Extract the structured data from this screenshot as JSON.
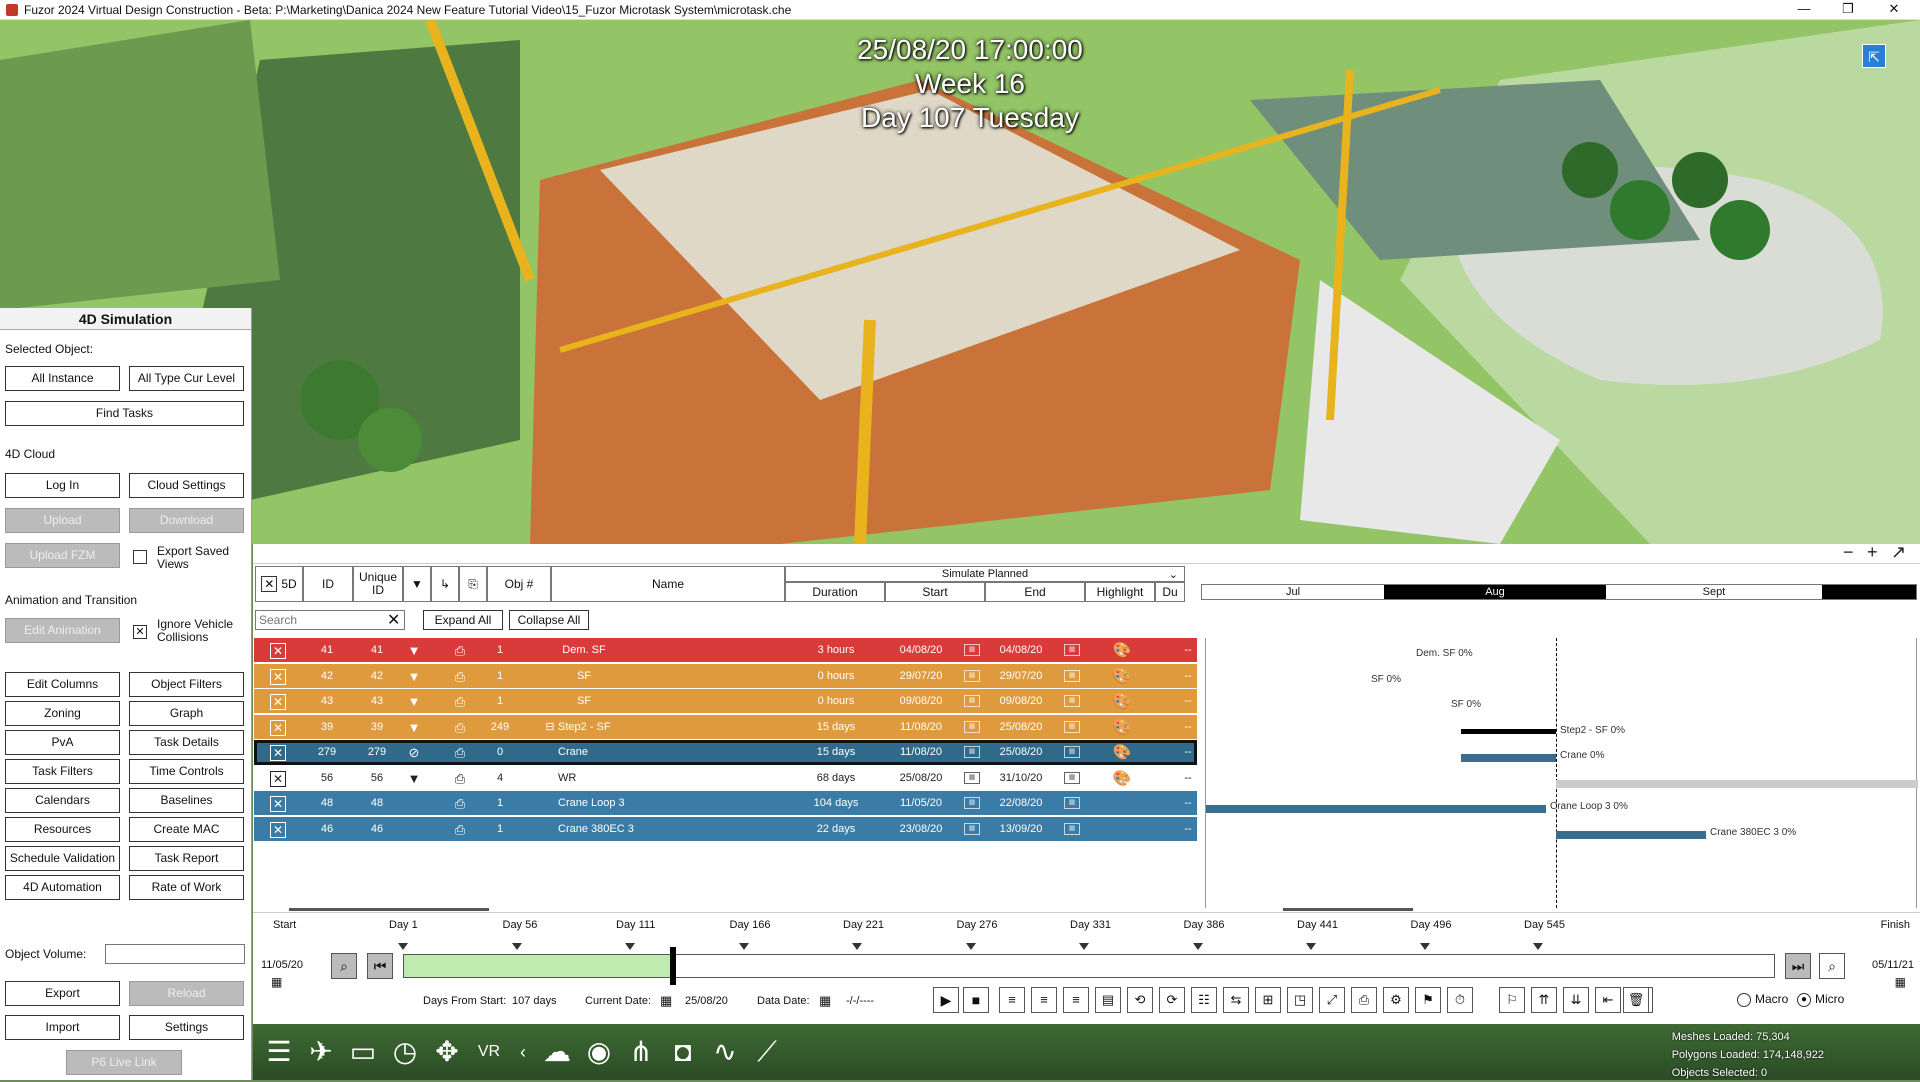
{
  "window": {
    "title": "Fuzor 2024 Virtual Design Construction - Beta: P:\\Marketing\\Danica 2024 New Feature Tutorial Video\\15_Fuzor Microtask System\\microtask.che",
    "minimize": "—",
    "restore": "❐",
    "close": "✕"
  },
  "overlay": {
    "datetime": "25/08/20 17:00:00",
    "week": "Week 16",
    "day": "Day 107 Tuesday"
  },
  "left_panel": {
    "title": "4D Simulation",
    "selected_object_label": "Selected Object:",
    "all_instance": "All Instance",
    "all_type_cur_level": "All Type Cur Level",
    "find_tasks": "Find Tasks",
    "cloud_label": "4D Cloud",
    "log_in": "Log In",
    "cloud_settings": "Cloud Settings",
    "upload": "Upload",
    "download": "Download",
    "upload_fzm": "Upload FZM",
    "export_saved_views": "Export Saved Views",
    "anim_label": "Animation and Transition",
    "edit_animation": "Edit Animation",
    "ignore_vehicle": "Ignore Vehicle Collisions",
    "buttons": [
      "Edit Columns",
      "Object Filters",
      "Zoning",
      "Graph",
      "PvA",
      "Task Details",
      "Task Filters",
      "Time Controls",
      "Calendars",
      "Baselines",
      "Resources",
      "Create MAC",
      "Schedule Validation",
      "Task Report",
      "4D Automation",
      "Rate of Work"
    ],
    "object_volume_label": "Object Volume:",
    "export": "Export",
    "reload": "Reload",
    "import": "Import",
    "settings": "Settings",
    "p6_live_link": "P6 Live Link"
  },
  "grid": {
    "hdr_5d": "5D",
    "hdr_id": "ID",
    "hdr_unique_id": "Unique ID",
    "hdr_obj": "Obj #",
    "hdr_name": "Name",
    "simulate_mode": "Simulate Planned",
    "hdr_duration": "Duration",
    "hdr_start": "Start",
    "hdr_end": "End",
    "hdr_highlight": "Highlight",
    "hdr_du": "Du",
    "search_placeholder": "Search",
    "expand_all": "Expand All",
    "collapse_all": "Collapse All",
    "rows": [
      {
        "id": "41",
        "uid": "41",
        "obj": "1",
        "name": "Dem. SF",
        "duration": "3 hours",
        "start": "04/08/20",
        "end": "04/08/20",
        "color": "#d93a3a"
      },
      {
        "id": "42",
        "uid": "42",
        "obj": "1",
        "name": "SF",
        "duration": "0 hours",
        "start": "29/07/20",
        "end": "29/07/20",
        "color": "#e09a3e"
      },
      {
        "id": "43",
        "uid": "43",
        "obj": "1",
        "name": "SF",
        "duration": "0 hours",
        "start": "09/08/20",
        "end": "09/08/20",
        "color": "#e09a3e"
      },
      {
        "id": "39",
        "uid": "39",
        "obj": "249",
        "name": "Step2 - SF",
        "duration": "15 days",
        "start": "11/08/20",
        "end": "25/08/20",
        "color": "#e09a3e"
      },
      {
        "id": "279",
        "uid": "279",
        "obj": "0",
        "name": "Crane",
        "duration": "15 days",
        "start": "11/08/20",
        "end": "25/08/20",
        "color": "#2f6a8a"
      },
      {
        "id": "56",
        "uid": "56",
        "obj": "4",
        "name": "WR",
        "duration": "68 days",
        "start": "25/08/20",
        "end": "31/10/20",
        "color": "#ffffff"
      },
      {
        "id": "48",
        "uid": "48",
        "obj": "1",
        "name": "Crane Loop 3",
        "duration": "104 days",
        "start": "11/05/20",
        "end": "22/08/20",
        "color": "#3a7ca5"
      },
      {
        "id": "46",
        "uid": "46",
        "obj": "1",
        "name": "Crane 380EC 3",
        "duration": "22 days",
        "start": "23/08/20",
        "end": "13/09/20",
        "color": "#3a7ca5"
      }
    ],
    "months": [
      "Jul",
      "Aug",
      "Sept"
    ],
    "gantt_labels": [
      "Dem. SF  0%",
      "SF  0%",
      "SF  0%",
      "Step2 - SF  0%",
      "Crane  0%",
      "Crane Loop 3  0%",
      "Crane 380EC 3  0%"
    ]
  },
  "timeline": {
    "start_label": "Start",
    "start_date": "11/05/20",
    "finish_label": "Finish",
    "finish_date": "05/11/21",
    "days": [
      "Day 1",
      "Day 56",
      "Day 111",
      "Day 166",
      "Day 221",
      "Day 276",
      "Day 331",
      "Day 386",
      "Day 441",
      "Day 496",
      "Day 545"
    ],
    "days_from_start_label": "Days From Start:",
    "days_from_start": "107 days",
    "current_date_label": "Current Date:",
    "current_date": "25/08/20",
    "data_date_label": "Data Date:",
    "data_date": "-/-/----",
    "macro": "Macro",
    "micro": "Micro",
    "progress": 0.196
  },
  "stats": {
    "meshes": "Meshes Loaded: 75,304",
    "polygons": "Polygons Loaded: 174,148,922",
    "objects": "Objects Selected: 0"
  }
}
